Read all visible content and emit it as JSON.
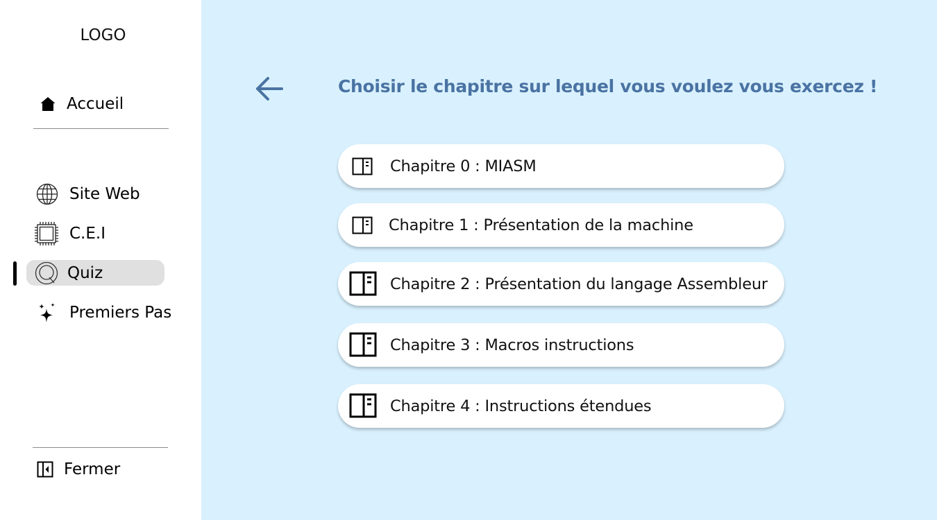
{
  "sidebar": {
    "logo": "LOGO",
    "home_label": "Accueil",
    "items": [
      {
        "label": "Site Web",
        "icon": "globe-icon"
      },
      {
        "label": "C.E.I",
        "icon": "chip-icon"
      },
      {
        "label": "Quiz",
        "icon": "quiz-icon",
        "active": true
      },
      {
        "label": "Premiers Pas",
        "icon": "sparkles-icon"
      }
    ],
    "close_label": "Fermer"
  },
  "main": {
    "title": "Choisir le chapitre sur lequel vous voulez vous exercez !",
    "chapters": [
      {
        "label": "Chapitre 0 : MIASM",
        "icon": "book-open-icon"
      },
      {
        "label": "Chapitre 1 : Présentation de la machine",
        "icon": "book-open-icon"
      },
      {
        "label": "Chapitre 2 : Présentation du langage Assembleur",
        "icon": "book-open-icon"
      },
      {
        "label": "Chapitre 3 : Macros instructions",
        "icon": "book-open-icon"
      },
      {
        "label": "Chapitre 4 : Instructions étendues",
        "icon": "book-open-icon"
      }
    ]
  },
  "colors": {
    "sidebar_bg": "#ffffff",
    "main_bg": "#d9f1fe",
    "title": "#4a73a3",
    "back_arrow": "#4a73a3",
    "active_pill": "#e0e0e0",
    "card_bg": "#ffffff"
  }
}
